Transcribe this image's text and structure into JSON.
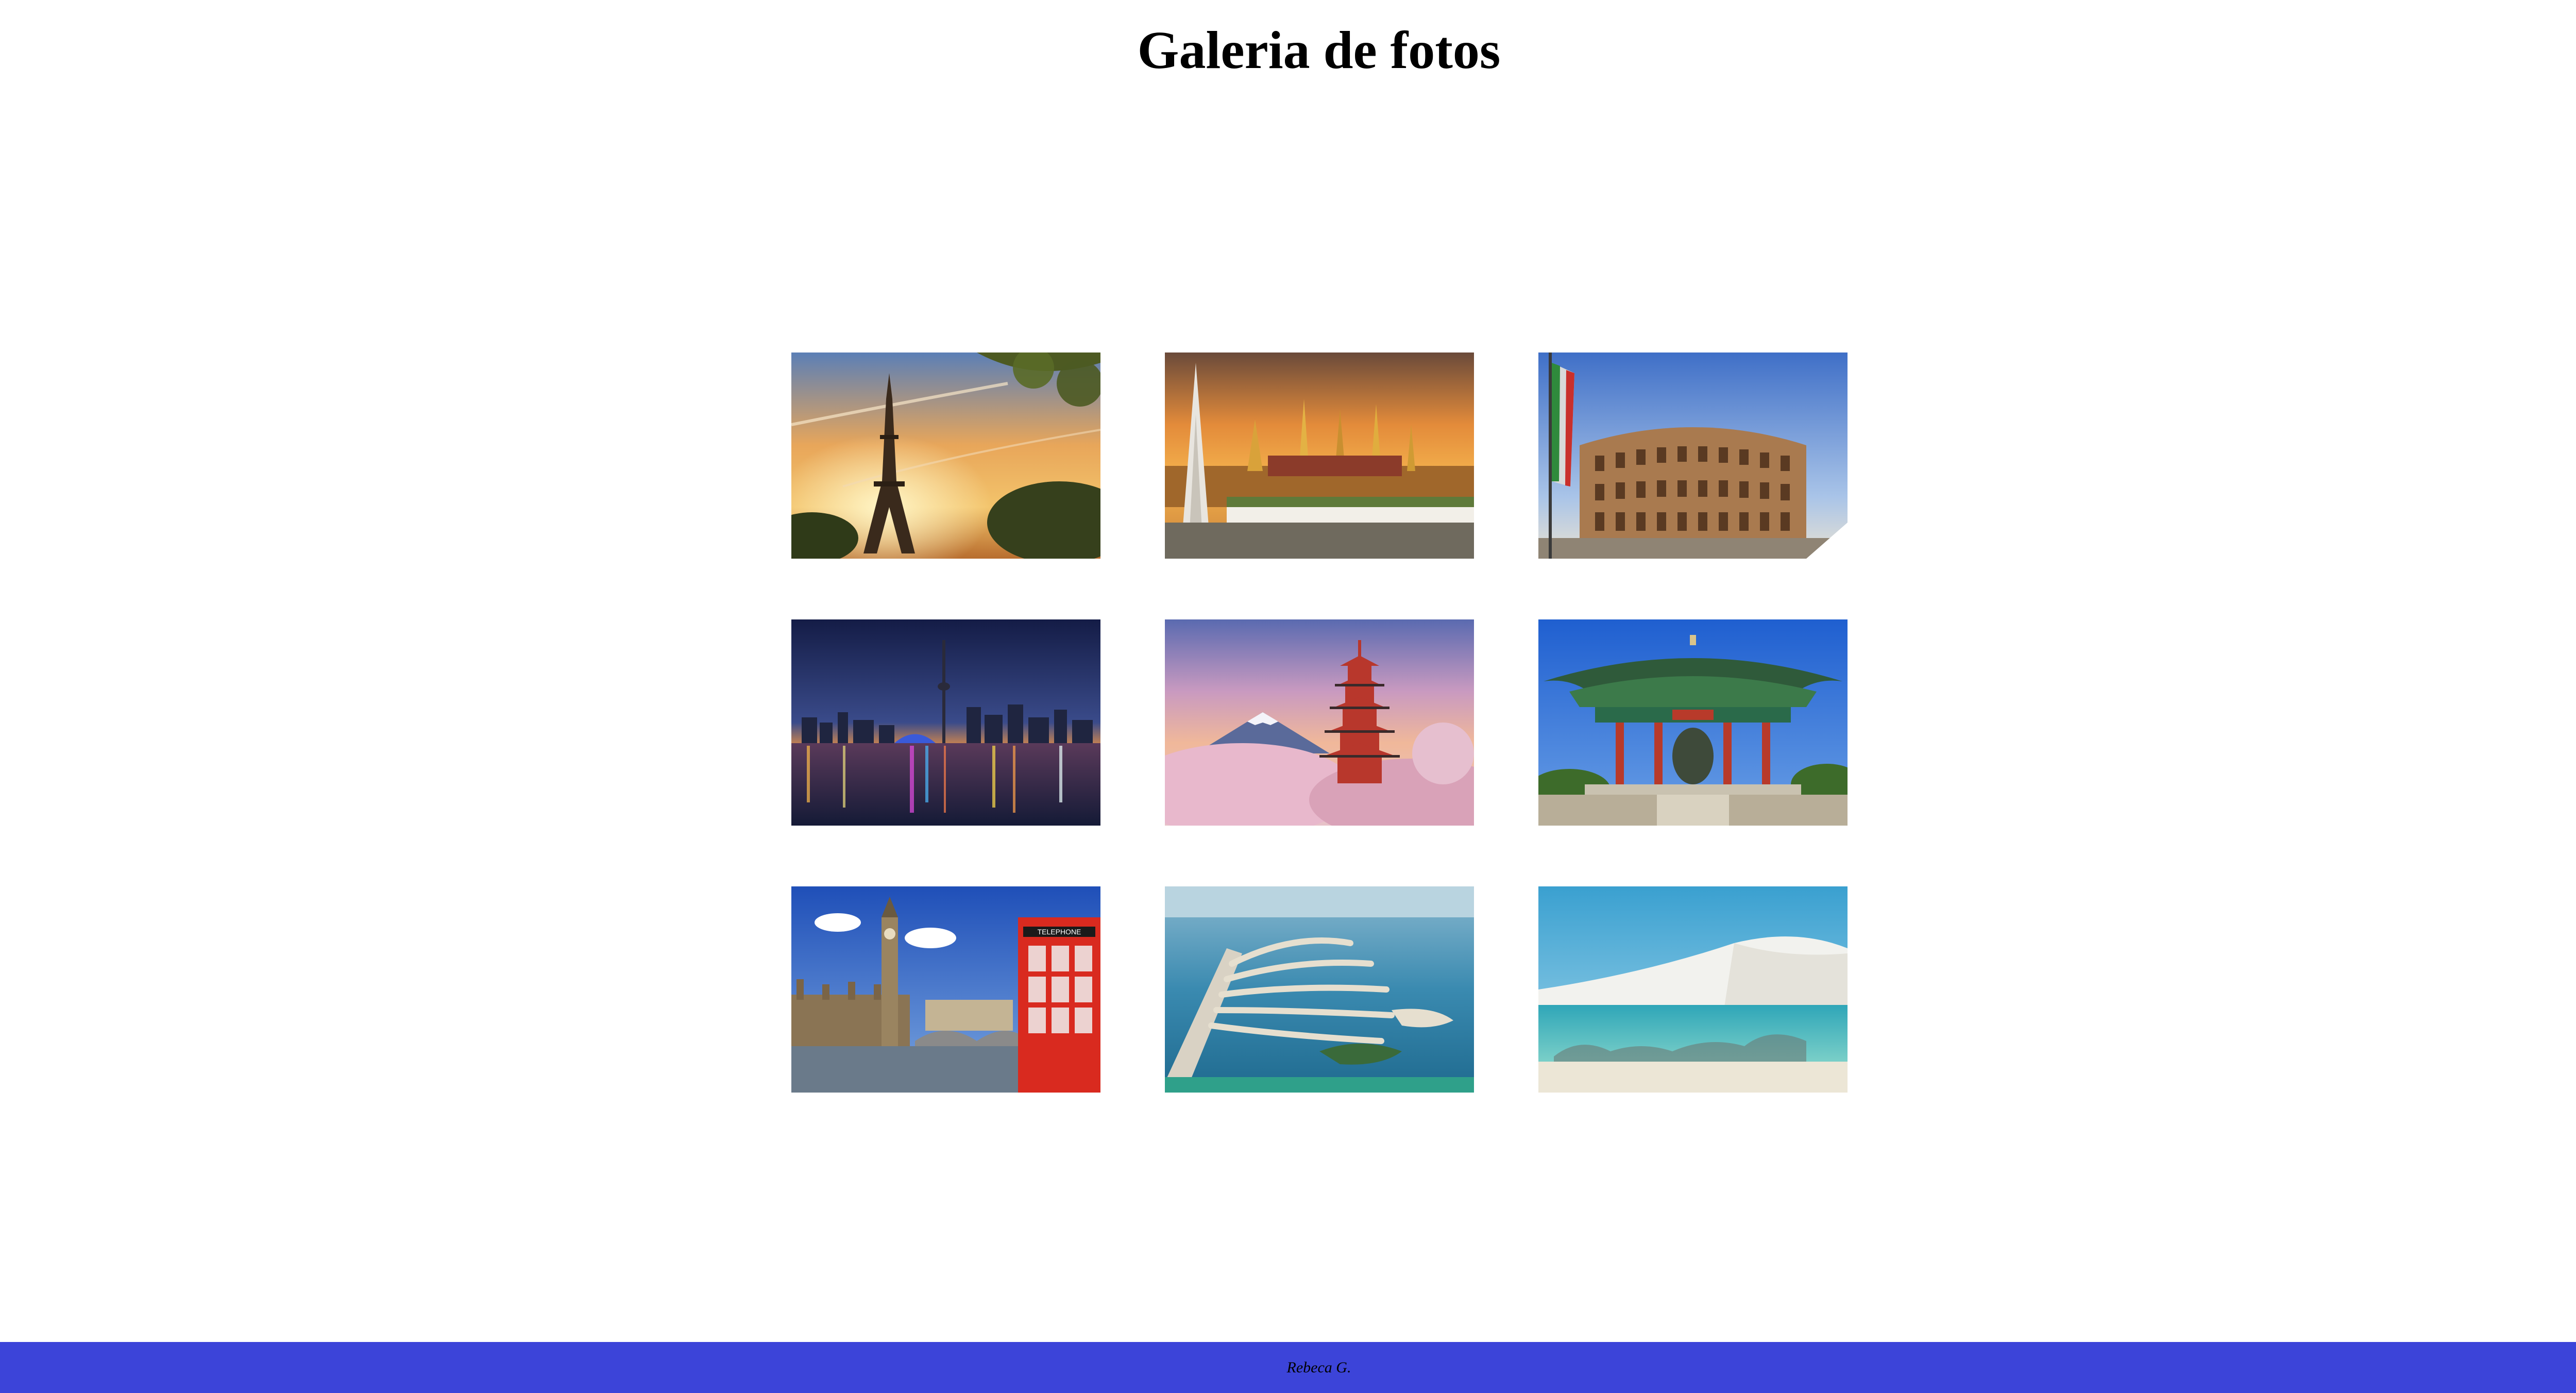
{
  "page": {
    "title": "Galeria de fotos"
  },
  "footer": {
    "author": "Rebeca G.",
    "background_color": "#3c44d9"
  },
  "gallery": {
    "photos": [
      {
        "subject": "eiffel-tower-paris"
      },
      {
        "subject": "grand-palace-bangkok"
      },
      {
        "subject": "colosseum-rome"
      },
      {
        "subject": "toronto-skyline-night"
      },
      {
        "subject": "pagoda-mount-fuji-cherry-blossoms"
      },
      {
        "subject": "korean-bell-pavilion"
      },
      {
        "subject": "big-ben-telephone-booth-london",
        "sign_text": "TELEPHONE"
      },
      {
        "subject": "palm-jumeirah-dubai"
      },
      {
        "subject": "lencois-maranhenses-lagoon"
      }
    ]
  }
}
